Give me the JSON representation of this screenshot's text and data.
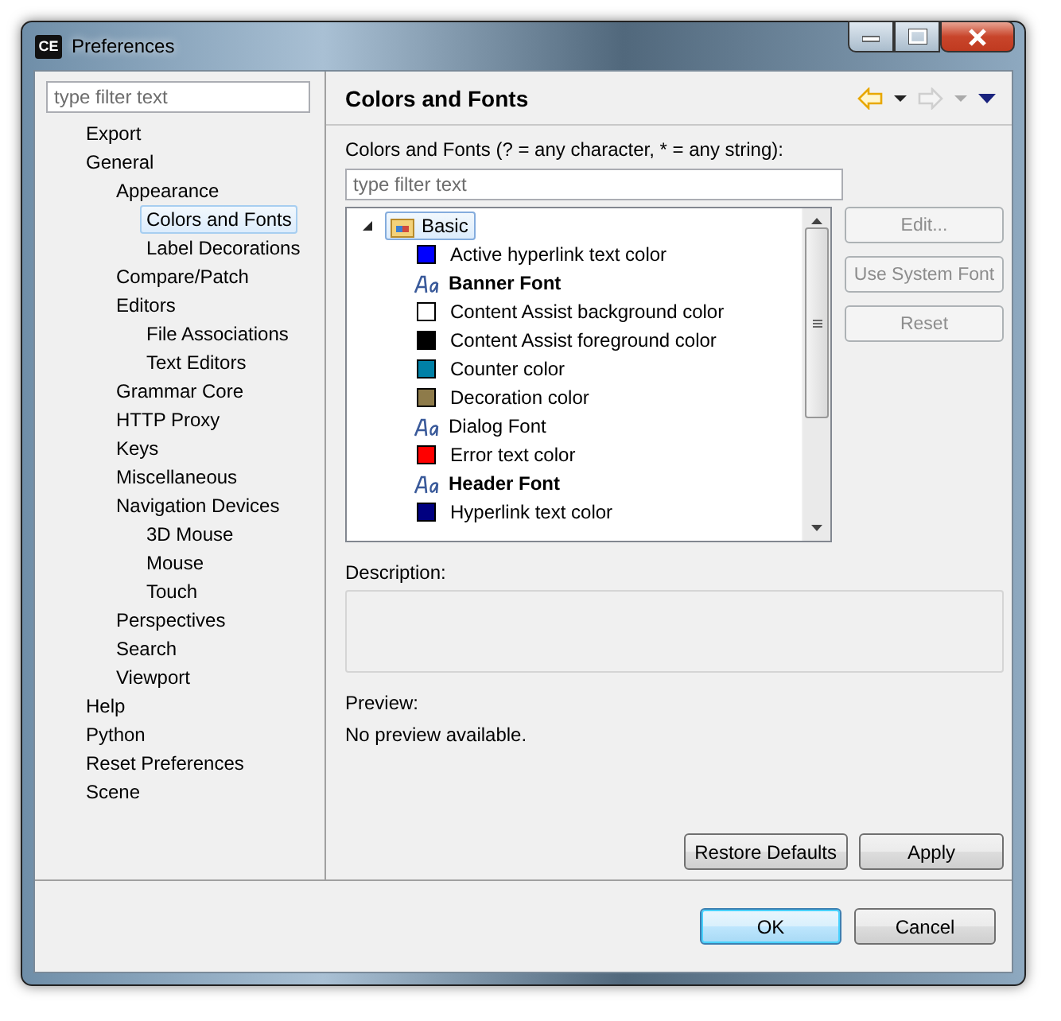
{
  "window": {
    "app_icon_text": "CE",
    "title": "Preferences"
  },
  "sidebar": {
    "filter": {
      "placeholder": "type filter text"
    },
    "items": [
      {
        "label": "Export",
        "selected": false
      },
      {
        "label": "General",
        "selected": false,
        "children": [
          {
            "label": "Appearance",
            "selected": false,
            "children": [
              {
                "label": "Colors and Fonts",
                "selected": true
              },
              {
                "label": "Label Decorations",
                "selected": false
              }
            ]
          },
          {
            "label": "Compare/Patch",
            "selected": false
          },
          {
            "label": "Editors",
            "selected": false,
            "children": [
              {
                "label": "File Associations",
                "selected": false
              },
              {
                "label": "Text Editors",
                "selected": false
              }
            ]
          },
          {
            "label": "Grammar Core",
            "selected": false
          },
          {
            "label": "HTTP Proxy",
            "selected": false
          },
          {
            "label": "Keys",
            "selected": false
          },
          {
            "label": "Miscellaneous",
            "selected": false
          },
          {
            "label": "Navigation Devices",
            "selected": false,
            "children": [
              {
                "label": "3D Mouse",
                "selected": false
              },
              {
                "label": "Mouse",
                "selected": false
              },
              {
                "label": "Touch",
                "selected": false
              }
            ]
          },
          {
            "label": "Perspectives",
            "selected": false
          },
          {
            "label": "Search",
            "selected": false
          },
          {
            "label": "Viewport",
            "selected": false
          }
        ]
      },
      {
        "label": "Help",
        "selected": false
      },
      {
        "label": "Python",
        "selected": false
      },
      {
        "label": "Reset Preferences",
        "selected": false
      },
      {
        "label": "Scene",
        "selected": false
      }
    ]
  },
  "page": {
    "title": "Colors and Fonts",
    "nav": {
      "back_enabled": true,
      "forward_enabled": false
    },
    "filter_label": "Colors and Fonts (? = any character, * = any string):",
    "filter": {
      "placeholder": "type filter text"
    },
    "tree": [
      {
        "label": "Basic",
        "expanded": true,
        "selected": true,
        "children": [
          {
            "label": "Active hyperlink text color",
            "kind": "color",
            "color": "#0000ff"
          },
          {
            "label": "Banner Font",
            "kind": "font",
            "bold": true
          },
          {
            "label": "Content Assist background color",
            "kind": "color",
            "color": "#ffffff"
          },
          {
            "label": "Content Assist foreground color",
            "kind": "color",
            "color": "#000000"
          },
          {
            "label": "Counter color",
            "kind": "color",
            "color": "#0080a6"
          },
          {
            "label": "Decoration color",
            "kind": "color",
            "color": "#8e7b4a"
          },
          {
            "label": "Dialog Font",
            "kind": "font",
            "bold": false
          },
          {
            "label": "Error text color",
            "kind": "color",
            "color": "#ff0000"
          },
          {
            "label": "Header Font",
            "kind": "font",
            "bold": true
          },
          {
            "label": "Hyperlink text color",
            "kind": "color",
            "color": "#000080"
          }
        ]
      }
    ],
    "side_buttons": [
      {
        "label": "Edit...",
        "disabled": true
      },
      {
        "label": "Use System Font",
        "disabled": true
      },
      {
        "label": "Reset",
        "disabled": true
      }
    ],
    "description_label": "Description:",
    "preview_label": "Preview:",
    "preview_text": "No preview available.",
    "page_buttons": [
      {
        "label": "Restore Defaults",
        "disabled": false
      },
      {
        "label": "Apply",
        "disabled": false
      }
    ]
  },
  "buttons": [
    {
      "label": "OK",
      "default": true
    },
    {
      "label": "Cancel",
      "default": false
    }
  ]
}
